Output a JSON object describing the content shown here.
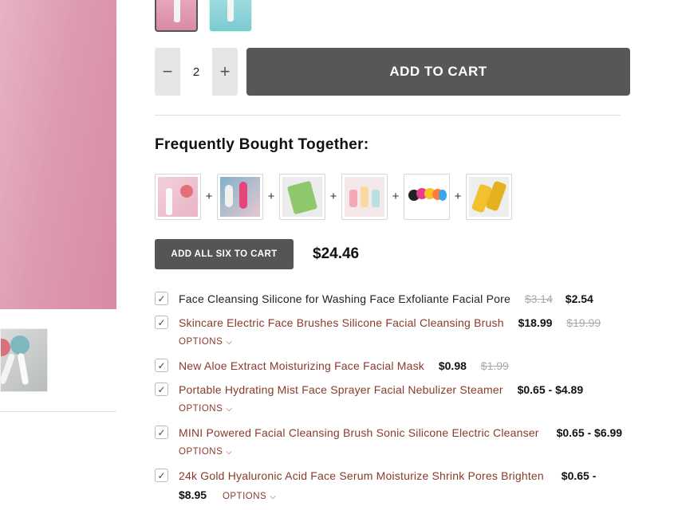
{
  "product": {
    "quantity": "2",
    "add_to_cart": "ADD TO CART"
  },
  "icons": {
    "minus": "−",
    "plus": "+",
    "check": "✓",
    "chevron": "⌵"
  },
  "fbt": {
    "title": "Frequently Bought Together:",
    "add_all": "ADD ALL SIX TO CART",
    "total": "$24.46",
    "options_label": "OPTIONS",
    "items": [
      {
        "name": "Face Cleansing Silicone for Washing Face Exfoliante Facial Pore",
        "old_price": "$3.14",
        "price": "$2.54"
      },
      {
        "name": "Skincare Electric Face Brushes Silicone Facial Cleansing Brush",
        "price": "$18.99",
        "old_price": "$19.99"
      },
      {
        "name": "New Aloe Extract Moisturizing Face Facial Mask",
        "price": "$0.98",
        "old_price": "$1.99"
      },
      {
        "name": "Portable Hydrating Mist Face Sprayer Facial Nebulizer Steamer",
        "price": "$0.65 - $4.89"
      },
      {
        "name": "MINI Powered Facial Cleansing Brush Sonic Silicone Electric Cleanser",
        "price": "$0.65 - $6.99"
      },
      {
        "name": "24k Gold Hyaluronic Acid Face Serum Moisturize Shrink Pores Brighten",
        "price_part1": "$0.65 -",
        "price_part2": "$8.95"
      }
    ]
  }
}
